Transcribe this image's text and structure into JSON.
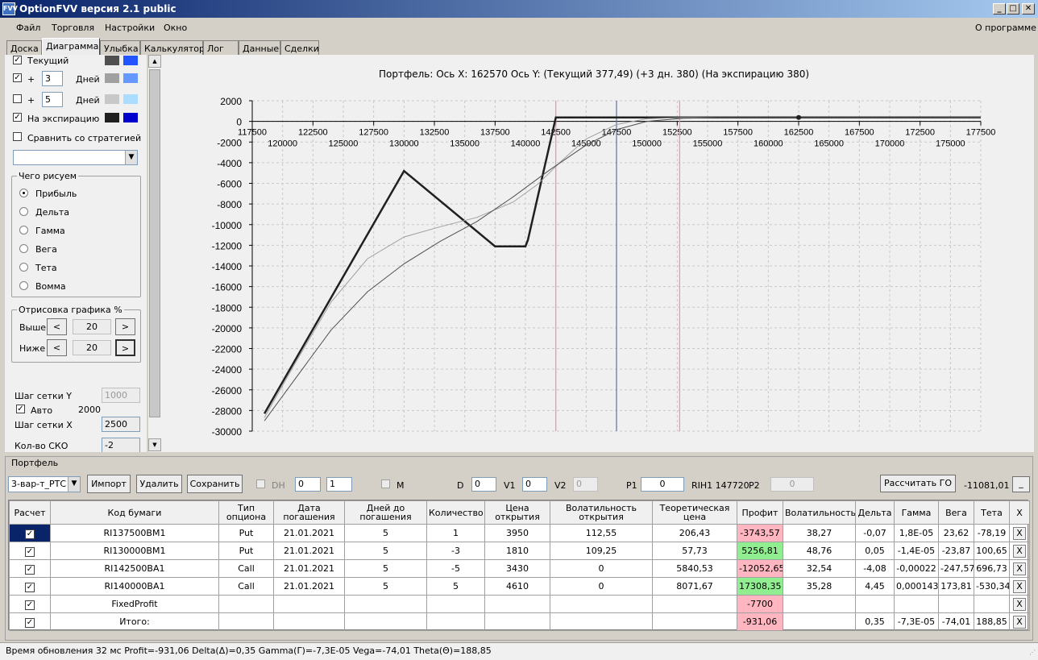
{
  "window": {
    "title": "OptionFVV версия 2.1 public",
    "icon": "FVV"
  },
  "menu": {
    "items": [
      "Файл",
      "Торговля",
      "Настройки",
      "Окно"
    ],
    "about": "О программе"
  },
  "tabs": [
    "Доска",
    "Диаграмма",
    "Улыбка",
    "Калькулятор",
    "Лог",
    "Данные",
    "Сделки"
  ],
  "left": {
    "current": {
      "label": "Текущий",
      "checked": true
    },
    "plus1": {
      "sign": "+",
      "value": "3",
      "unit": "Дней",
      "checked": true
    },
    "plus2": {
      "sign": "+",
      "value": "5",
      "unit": "Дней",
      "checked": false
    },
    "expiry": {
      "label": "На экспирацию",
      "checked": true
    },
    "compare": {
      "label": "Сравнить со стратегией",
      "checked": false
    },
    "what_title": "Чего рисуем",
    "what_options": [
      "Прибыль",
      "Дельта",
      "Гамма",
      "Вега",
      "Тета",
      "Вомма"
    ],
    "what_selected": 0,
    "draw_title": "Отрисовка графика %",
    "above_label": "Выше",
    "above_value": "20",
    "below_label": "Ниже",
    "below_value": "20",
    "prev": "<",
    "next": ">",
    "gridY_label": "Шаг сетки Y",
    "gridY_value": "1000",
    "auto_label": "Авто",
    "auto_value": "2000",
    "gridX_label": "Шаг сетки X",
    "gridX_value": "2500",
    "sko_label": "Кол-во СКО",
    "sko_value": "-2",
    "colors": {
      "current": [
        "#505050",
        "#2255ff"
      ],
      "plus1": [
        "#a0a0a0",
        "#6699ff"
      ],
      "plus2": [
        "#c8c8c8",
        "#aaddff"
      ],
      "expiry": [
        "#202020",
        "#0000cc"
      ]
    }
  },
  "chart_header": "Портфель: Ось X:  162570 Ось Y:  (Текущий 377,49)  (+3 дн. 380)  (На экспирацию 380)",
  "chart_data": {
    "type": "line",
    "x_range": [
      117500,
      177500
    ],
    "y_range": [
      -30000,
      2000
    ],
    "x_ticks_top": [
      "117500",
      "122500",
      "127500",
      "132500",
      "137500",
      "142500",
      "147500",
      "152500",
      "157500",
      "162500",
      "167500",
      "172500",
      "177500"
    ],
    "x_ticks_bottom": [
      "120000",
      "125000",
      "130000",
      "135000",
      "140000",
      "145000",
      "150000",
      "155000",
      "160000",
      "165000",
      "170000",
      "175000"
    ],
    "y_ticks": [
      "2000",
      "0",
      "-2000",
      "-4000",
      "-6000",
      "-8000",
      "-10000",
      "-12000",
      "-14000",
      "-16000",
      "-18000",
      "-20000",
      "-22000",
      "-24000",
      "-26000",
      "-28000",
      "-30000"
    ],
    "grid": true,
    "series": [
      {
        "color": "#202020",
        "points": [
          [
            118500,
            -28300
          ],
          [
            130000,
            -4800
          ],
          [
            137500,
            -12100
          ],
          [
            140000,
            -12100
          ],
          [
            140200,
            -11500
          ],
          [
            142500,
            380
          ],
          [
            177500,
            380
          ]
        ]
      },
      {
        "color": "#a0a0a0",
        "points": [
          [
            118500,
            -28700
          ],
          [
            121000,
            -23500
          ],
          [
            124000,
            -17500
          ],
          [
            127000,
            -13300
          ],
          [
            130000,
            -11200
          ],
          [
            133000,
            -10200
          ],
          [
            136000,
            -9300
          ],
          [
            139000,
            -7800
          ],
          [
            141000,
            -6100
          ],
          [
            143000,
            -3800
          ],
          [
            145000,
            -1700
          ],
          [
            147500,
            -300
          ],
          [
            150000,
            250
          ],
          [
            153000,
            370
          ],
          [
            177500,
            380
          ]
        ]
      },
      {
        "color": "#505050",
        "points": [
          [
            118500,
            -29000
          ],
          [
            121000,
            -25000
          ],
          [
            124000,
            -20200
          ],
          [
            127000,
            -16500
          ],
          [
            130000,
            -13800
          ],
          [
            133000,
            -11600
          ],
          [
            136000,
            -9700
          ],
          [
            139000,
            -7300
          ],
          [
            142000,
            -4700
          ],
          [
            145000,
            -2300
          ],
          [
            147500,
            -800
          ],
          [
            150000,
            0
          ],
          [
            153000,
            300
          ],
          [
            156000,
            370
          ],
          [
            177500,
            377
          ]
        ]
      }
    ],
    "marker_x": 162500,
    "vlines": [
      {
        "x": 142500,
        "color": "#ff8aa0"
      },
      {
        "x": 147500,
        "color": "#6070a0"
      },
      {
        "x": 152700,
        "color": "#ff8aa0"
      }
    ]
  },
  "portfolio": {
    "title": "Портфель",
    "select": "3-вар-т_РТС",
    "import": "Импорт",
    "delete": "Удалить",
    "save": "Сохранить",
    "dh": "DH",
    "spin1": "0",
    "spin2": "1",
    "m": "M",
    "d_label": "D",
    "d_val": "0",
    "v1_label": "V1",
    "v1_val": "0",
    "v2_label": "V2",
    "v2_val": "0",
    "p1_label": "P1",
    "p1_val": "0",
    "rih": "RIH1 147720",
    "p2_label": "P2",
    "p2_val": "0",
    "calc": "Рассчитать ГО",
    "go_val": "-11081,01 п",
    "min": "_"
  },
  "table": {
    "headers": [
      "Расчет",
      "Код бумаги",
      "Тип опциона",
      "Дата погашения",
      "Дней до погашения",
      "Количество",
      "Цена открытия",
      "Волатильность открытия",
      "Теоретическая цена",
      "Профит",
      "Волатильность",
      "Дельта",
      "Гамма",
      "Вега",
      "Тета",
      "X"
    ],
    "rows": [
      [
        "RI137500BM1",
        "Put",
        "21.01.2021",
        "5",
        "1",
        "3950",
        "112,55",
        "206,43",
        "-3743,57",
        "38,27",
        "-0,07",
        "1,8E-05",
        "23,62",
        "-78,19"
      ],
      [
        "RI130000BM1",
        "Put",
        "21.01.2021",
        "5",
        "-3",
        "1810",
        "109,25",
        "57,73",
        "5256,81",
        "48,76",
        "0,05",
        "-1,4E-05",
        "-23,87",
        "100,65"
      ],
      [
        "RI142500BA1",
        "Call",
        "21.01.2021",
        "5",
        "-5",
        "3430",
        "0",
        "5840,53",
        "-12052,65",
        "32,54",
        "-4,08",
        "-0,00022",
        "-247,57",
        "696,73"
      ],
      [
        "RI140000BA1",
        "Call",
        "21.01.2021",
        "5",
        "5",
        "4610",
        "0",
        "8071,67",
        "17308,35",
        "35,28",
        "4,45",
        "0,000143",
        "173,81",
        "-530,34"
      ],
      [
        "FixedProfit",
        "",
        "",
        "",
        "",
        "",
        "",
        "",
        "-7700",
        "",
        "",
        "",
        "",
        ""
      ],
      [
        "Итого:",
        "",
        "",
        "",
        "",
        "",
        "",
        "",
        "-931,06",
        "",
        "0,35",
        "-7,3E-05",
        "-74,01",
        "188,85"
      ]
    ],
    "xlabel": "X"
  },
  "status": "Время обновления 32 мс  Profit=-931,06 Delta(Δ)=0,35 Gamma(Γ)=-7,3E-05 Vega=-74,01 Theta(Θ)=188,85"
}
